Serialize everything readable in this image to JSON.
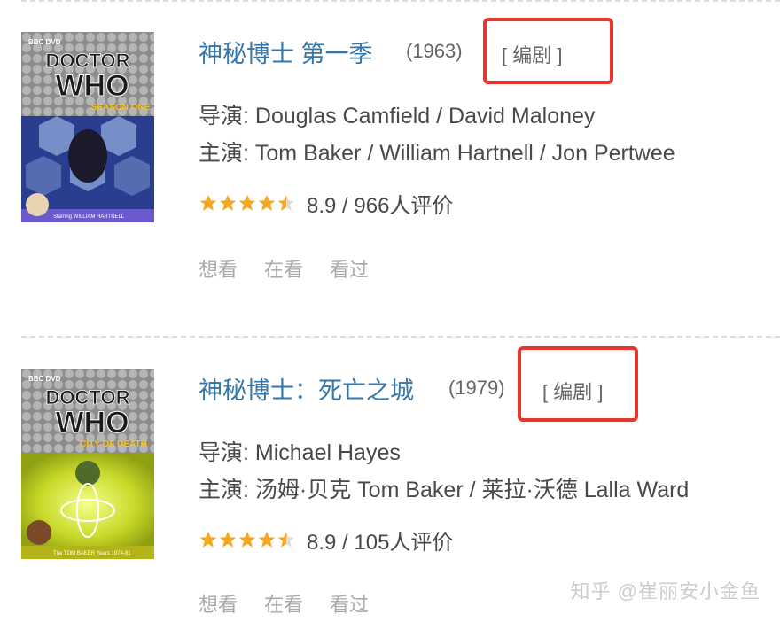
{
  "entries": [
    {
      "title": "神秘博士 第一季",
      "year": "(1963)",
      "role": "[ 编剧 ]",
      "director": "导演: Douglas Camfield / David Maloney",
      "cast": "主演: Tom Baker / William Hartnell / Jon Pertwee",
      "stars": 4.5,
      "rating_text": "8.9 / 966人评价",
      "poster": {
        "brand": "BBC DVD",
        "logo_top": "DOCTOR",
        "logo_bottom": "WHO",
        "subtitle": "SEASON ONE",
        "footer": "Starring WILLIAM HARTNELL"
      },
      "actions": [
        "想看",
        "在看",
        "看过"
      ]
    },
    {
      "title": "神秘博士：死亡之城",
      "year": "(1979)",
      "role": "[ 编剧 ]",
      "director": "导演: Michael Hayes",
      "cast": "主演: 汤姆·贝克 Tom Baker / 莱拉·沃德 Lalla Ward",
      "stars": 4.5,
      "rating_text": "8.9 / 105人评价",
      "poster": {
        "brand": "BBC DVD",
        "logo_top": "DOCTOR",
        "logo_bottom": "WHO",
        "subtitle": "CITY OF DEATH",
        "footer": "The TOM BAKER Years 1974-81"
      },
      "actions": [
        "想看",
        "在看",
        "看过"
      ]
    }
  ],
  "watermark": "知乎 @崔丽安小金鱼",
  "colors": {
    "title_link": "#3377aa",
    "highlight_box": "#e8362e",
    "star": "#f5a623",
    "star_empty": "#dddddd",
    "action_text": "#aaaaaa"
  }
}
